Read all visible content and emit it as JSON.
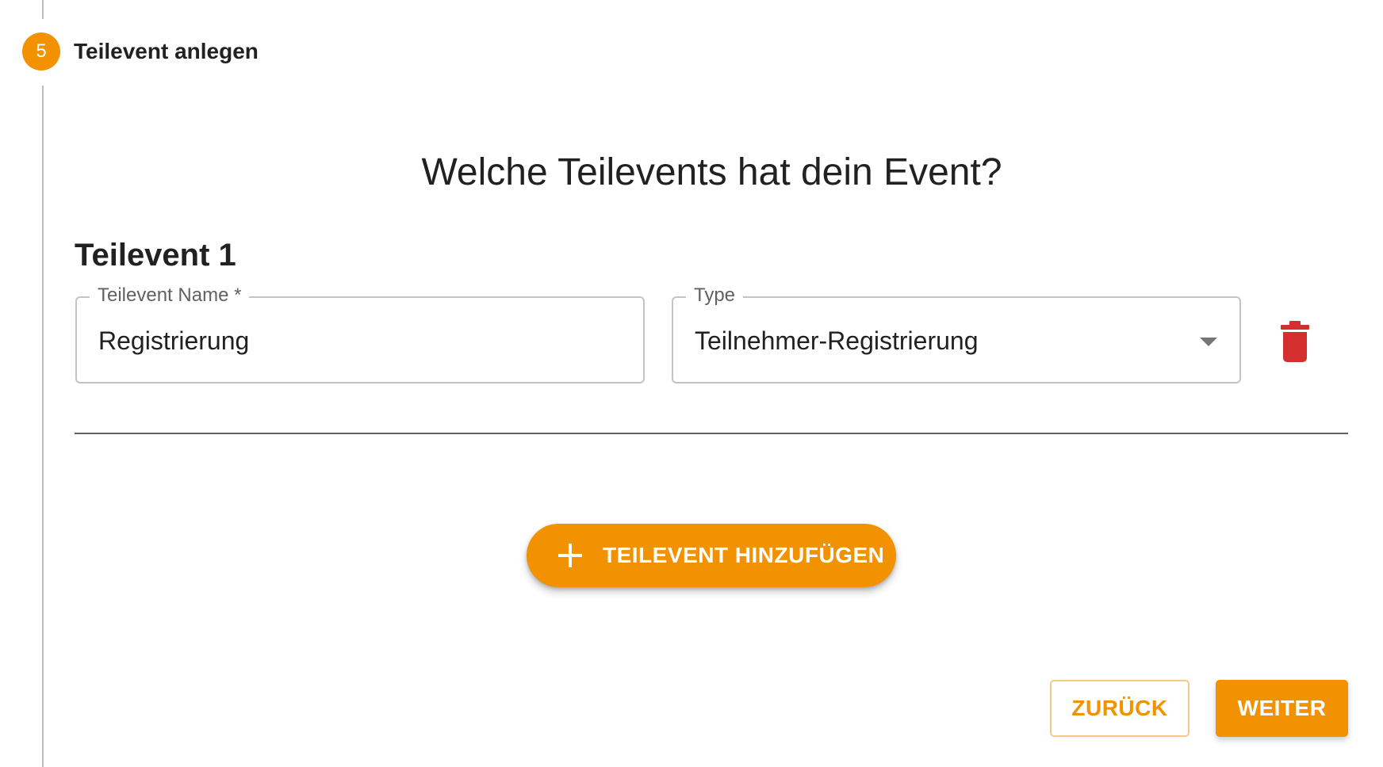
{
  "stepper": {
    "number": "5",
    "title": "Teilevent anlegen"
  },
  "main": {
    "question": "Welche Teilevents hat dein Event?",
    "subevents": [
      {
        "heading": "Teilevent 1",
        "name_field": {
          "label": "Teilevent Name *",
          "value": "Registrierung"
        },
        "type_field": {
          "label": "Type",
          "value": "Teilnehmer-Registrierung"
        },
        "delete_icon": "trash-icon"
      }
    ],
    "add_button": {
      "icon": "plus-icon",
      "label": "TEILEVENT HINZUFÜGEN"
    }
  },
  "footer": {
    "back_label": "ZURÜCK",
    "next_label": "WEITER"
  },
  "colors": {
    "accent": "#f29200",
    "delete": "#d32f2f",
    "text": "#212121",
    "label": "#616161",
    "border": "#c4c4c4"
  }
}
